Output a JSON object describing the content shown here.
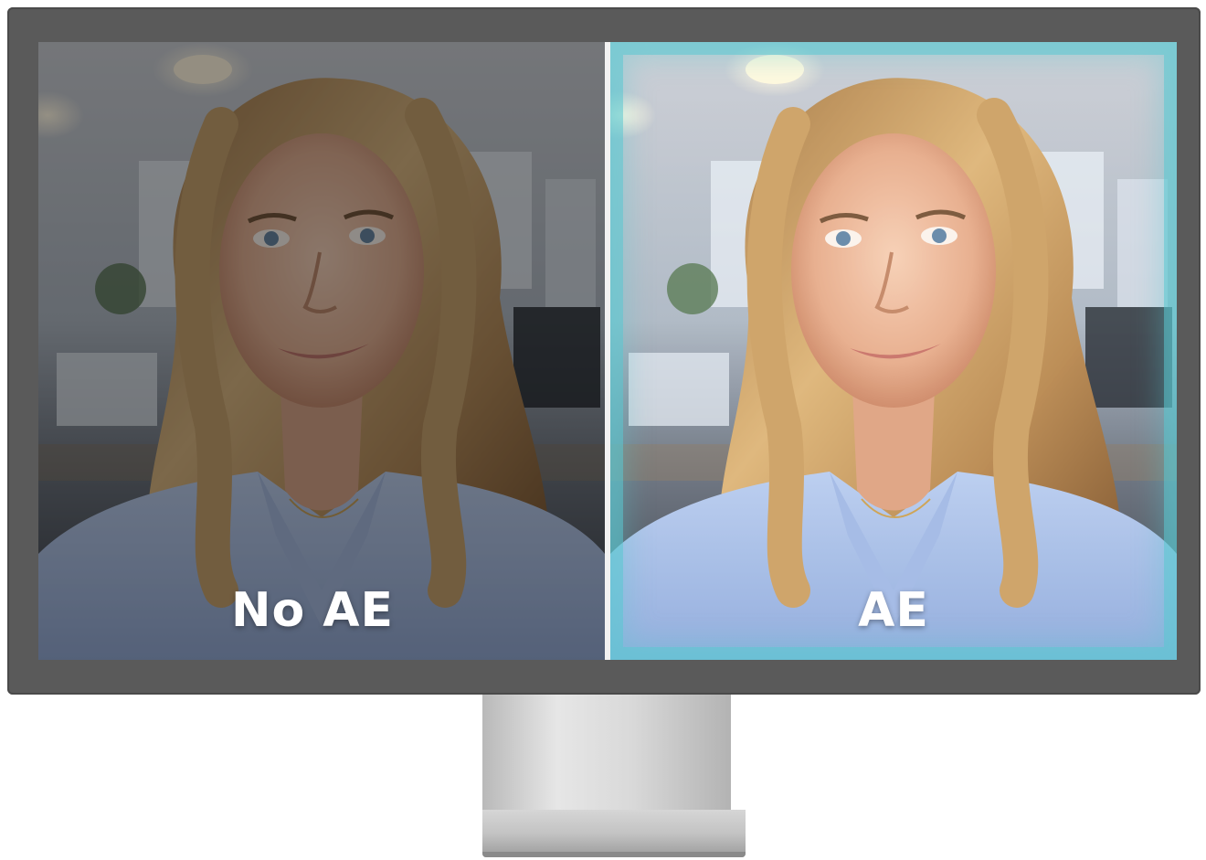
{
  "comparison": {
    "left_label": "No AE",
    "right_label": "AE"
  },
  "colors": {
    "monitor_bezel": "#5a5a5a",
    "divider": "#f2f2f2",
    "ae_glow": "#5ac8d2",
    "stand": "#cfcfcf",
    "label_text": "#ffffff"
  }
}
